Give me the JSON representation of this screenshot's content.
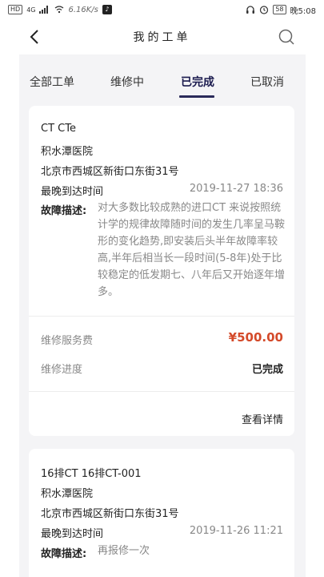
{
  "status_bar": {
    "network": "HD",
    "signal": "4G",
    "speed": "6.16K/s",
    "battery": "58",
    "time": "晚5:08"
  },
  "header": {
    "title": "我的工单"
  },
  "tabs": [
    {
      "label": "全部工单",
      "active": false
    },
    {
      "label": "维修中",
      "active": false
    },
    {
      "label": "已完成",
      "active": true
    },
    {
      "label": "已取消",
      "active": false
    }
  ],
  "orders": [
    {
      "device": "CT CTe",
      "hospital": "积水潭医院",
      "address": "北京市西城区新街口东街31号",
      "deadline_label": "最晚到达时间",
      "deadline": "2019-11-27 18:36",
      "fault_label": "故障描述:",
      "fault": "对大多数比较成熟的进口CT 来说按照统计学的规律故障随时间的发生几率呈马鞍形的变化趋势,即安装后头半年故障率较高,半年后相当长一段时间(5-8年)处于比较稳定的低发期七、八年后又开始逐年增多。",
      "fee_label": "维修服务费",
      "fee": "¥500.00",
      "progress_label": "维修进度",
      "progress": "已完成",
      "detail_label": "查看详情"
    },
    {
      "device": "16排CT 16排CT-001",
      "hospital": "积水潭医院",
      "address": "北京市西城区新街口东街31号",
      "deadline_label": "最晚到达时间",
      "deadline": "2019-11-26 11:21",
      "fault_label": "故障描述:",
      "fault": "再报修一次"
    }
  ],
  "colors": {
    "accent": "#2a2a5a",
    "fee": "#d44a2a",
    "background": "#f4f4f6"
  }
}
